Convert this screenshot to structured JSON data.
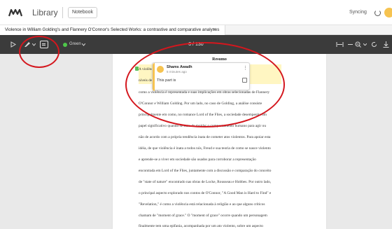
{
  "header": {
    "app_title": "Library",
    "notebook_label": "Notebook",
    "sync_status": "Syncing"
  },
  "tab": {
    "title": "Violence in William Golding's and Flannery O'Connor's Selected Works: a contrastive and comparative analyses",
    "close_icon": "×"
  },
  "toolbar": {
    "color_label": "Green",
    "page_counter": "8 / 130",
    "colors": {
      "background": "#3b3b3b",
      "highlight_green": "#4ec84a"
    }
  },
  "document": {
    "heading": "Resumo",
    "lines": [
      "A violência                                                         assim, por meio de diferentes",
      "níveis                                                              de mestrado é analisar",
      "como a violência é representada e suas implicações em obras selecionadas de Flannery",
      "O'Connor e William Golding. Por um lado, no caso de Golding, a análise consiste",
      "principalmente em como, no romance Lord of the Flies, a sociedade desempenha um",
      "papel significativo quando se trata de moldar o comportamento humano para agir ou",
      "não de acordo com a própria tendência inata de cometer atos violentos. Para apoiar esta",
      "idéia, de que violência é inata a todos nós, Freud e sua teoria de como se nasce violento",
      "e aprende-se a viver em sociedade são usados para corroborar a representação",
      "encontrada em Lord of the Flies, juntamente com a discussão e comparação do conceito",
      "de \"state of nature\" encontrado nas obras de Locke, Rousseau e Hobbes. Por outro lado,",
      "o principal aspecto explorado nos contos de O'Connor, \"A Good Man is Hard to Find\" e",
      "\"Revelation,\" é como a violência está relacionada à religião e ao que alguns críticos",
      "chamam de \"moment of grace.\" O \"moment of grace\" ocorre quando um personagem",
      "finalmente tem uma epifania, acompanhada por um ato violento, sobre um aspecto"
    ]
  },
  "comment": {
    "author": "Shams Awadh",
    "time": "5 minutes ago",
    "body": "This part is",
    "menu_icon": "⋮"
  },
  "colors": {
    "annotation_red": "#d4171e",
    "comment_accent": "#f6c350"
  }
}
